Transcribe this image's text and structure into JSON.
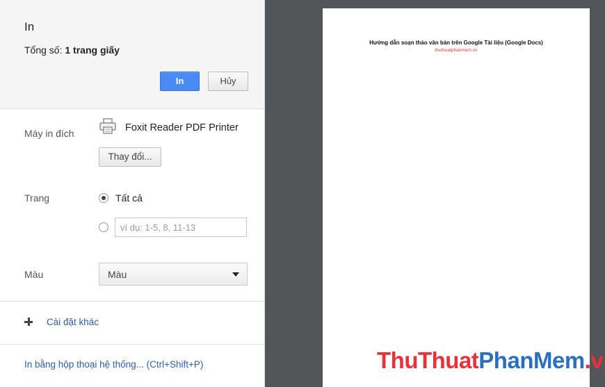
{
  "sidebar": {
    "title": "In",
    "summary_label": "Tổng số:",
    "summary_value": "1 trang giấy",
    "print_button": "In",
    "cancel_button": "Hủy",
    "destination": {
      "label": "Máy in đích",
      "printer_icon": "printer-icon",
      "printer_name": "Foxit Reader PDF Printer",
      "change_button": "Thay đổi..."
    },
    "pages": {
      "label": "Trang",
      "all_option": "Tất cả",
      "all_selected": true,
      "custom_placeholder": "ví dụ: 1-5, 8, 11-13",
      "custom_value": ""
    },
    "color": {
      "label": "Màu",
      "selected": "Màu"
    },
    "more_settings": "Cài đặt khác",
    "system_dialog": "In bằng hộp thoại hệ thống... (Ctrl+Shift+P)"
  },
  "preview": {
    "doc_title": "Hướng dẫn soạn thảo văn bản trên Google Tài liệu (Google Docs)",
    "doc_subtitle": "thuthuatphanmem.vn",
    "subtitle_color": "#e53935"
  },
  "watermark": {
    "part1": "ThuThuat",
    "part2": "PhanMem",
    "part3": ".vn",
    "color_red": "#e8313a",
    "color_blue": "#2b6fc2"
  },
  "colors": {
    "accent": "#4a8af4",
    "preview_bg": "#525659",
    "link": "#2a5db0"
  }
}
